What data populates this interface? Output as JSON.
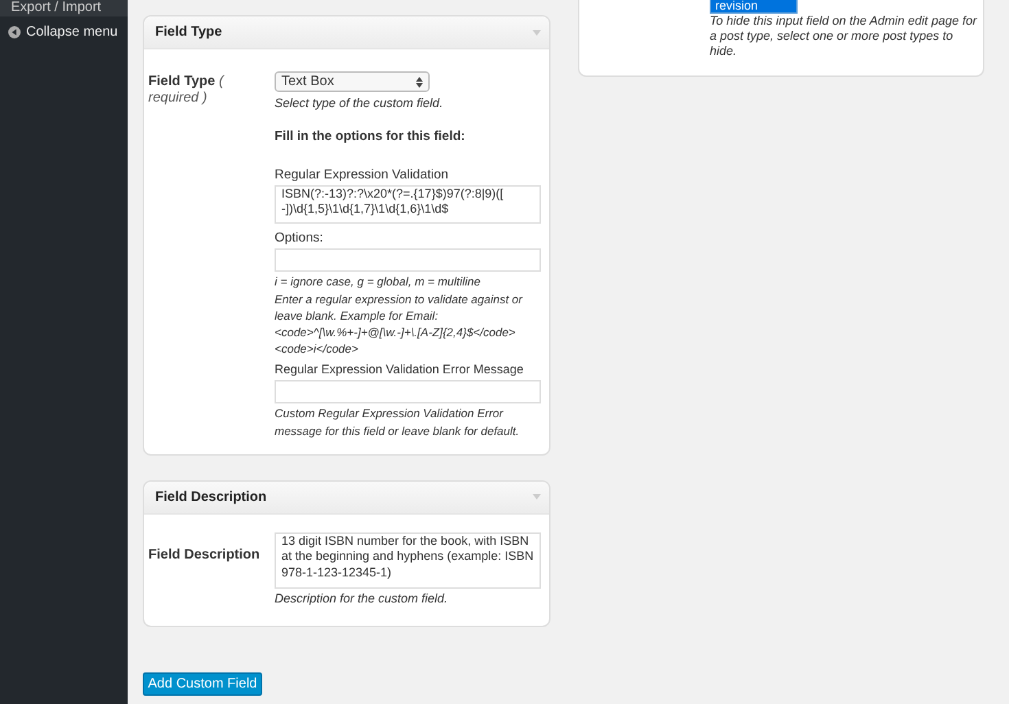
{
  "sidebar": {
    "items": [
      {
        "label": "Export / Import",
        "kind": "link"
      },
      {
        "label": "Collapse menu",
        "kind": "collapse"
      }
    ]
  },
  "field_type_panel": {
    "title": "Field Type",
    "label": "Field Type",
    "label_note": "( required )",
    "select": {
      "value": "Text Box"
    },
    "select_help": "Select type of the custom field.",
    "options_heading": "Fill in the options for this field:",
    "regex": {
      "label": "Regular Expression Validation",
      "value": "ISBN(?:-13)?:?\\x20*(?=.{17}$)97(?:8|9)([ -])\\d{1,5}\\1\\d{1,7}\\1\\d{1,6}\\1\\d$"
    },
    "options": {
      "label": "Options:",
      "help": [
        "i = ignore case, g = global, m = multiline",
        "Enter a regular expression to validate against or leave blank. Example for Email: <code>^[\\w.%+-]+@[\\w.-]+\\.[A-Z]{2,4}$</code> <code>i</code>"
      ]
    },
    "error_message": {
      "label": "Regular Expression Validation Error Message",
      "help": "Custom Regular Expression Validation Error message for this field or leave blank for default."
    }
  },
  "field_description_panel": {
    "title": "Field Description",
    "label": "Field Description",
    "value": "13 digit ISBN number for the book, with ISBN at the beginning and hyphens (example: ISBN 978-1-123-12345-1)",
    "help": "Description for the custom field."
  },
  "hide_panel": {
    "list": [
      {
        "label": "revision",
        "selected": true
      }
    ],
    "help": "To hide this input field on the Admin edit page for a post type, select one or more post types to hide."
  },
  "submit_button": "Add Custom Field"
}
